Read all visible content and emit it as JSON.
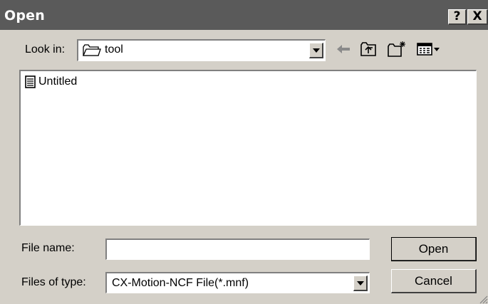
{
  "dialog": {
    "title": "Open",
    "help_glyph": "?",
    "close_glyph": "X"
  },
  "look_in": {
    "label": "Look in:",
    "value": "tool"
  },
  "toolbar": {
    "icons": [
      "back-arrow-icon",
      "up-folder-icon",
      "new-folder-icon",
      "view-menu-icon"
    ]
  },
  "files": [
    {
      "name": "Untitled",
      "icon": "document-icon"
    }
  ],
  "file_name": {
    "label": "File name:",
    "value": "",
    "placeholder": ""
  },
  "files_of_type": {
    "label": "Files of type:",
    "value": "CX-Motion-NCF File(*.mnf)"
  },
  "buttons": {
    "open": "Open",
    "cancel": "Cancel"
  }
}
